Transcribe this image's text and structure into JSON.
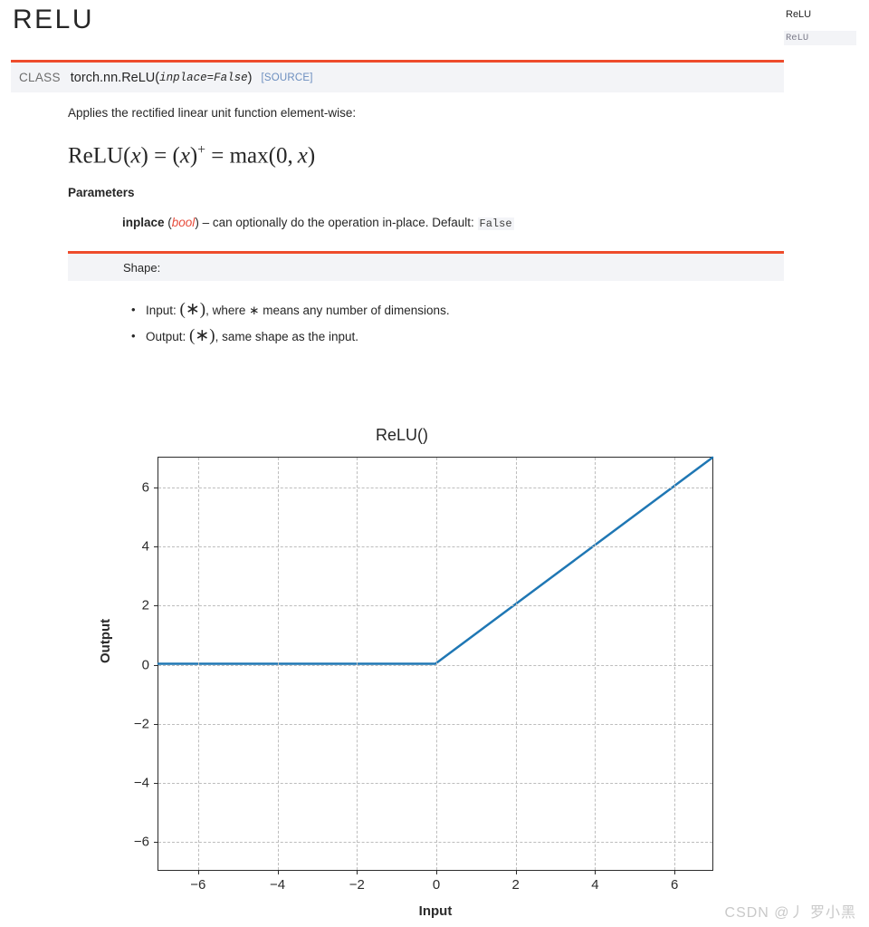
{
  "page": {
    "title": "RELU",
    "watermark": "CSDN @丿 罗小黑"
  },
  "sidebar": {
    "items": [
      {
        "label": "ReLU",
        "style": "link"
      },
      {
        "label": "ReLU",
        "style": "current"
      }
    ]
  },
  "signature": {
    "class_label": "CLASS",
    "qualified_name": "torch.nn.ReLU",
    "open_paren": "(",
    "argument": "inplace=False",
    "close_paren": ")",
    "source_link": "[SOURCE]",
    "accent_color": "#ee4c2c",
    "band_color": "#f3f4f7"
  },
  "description": "Applies the rectified linear unit function element-wise:",
  "formula": {
    "lhs_fn": "ReLU",
    "lhs_arg": "x",
    "plus_form": "(x)",
    "plus_sup": "+",
    "rhs": "max(0, x)",
    "plain": "ReLU(x) = (x)+ = max(0, x)"
  },
  "parameters": {
    "heading": "Parameters",
    "rows": [
      {
        "name": "inplace",
        "type": "bool",
        "description": "– can optionally do the operation in-place. Default:",
        "default": "False"
      }
    ]
  },
  "shape": {
    "heading": "Shape:",
    "items": [
      {
        "label": "Input:",
        "symbol": "(∗)",
        "text": ", where ∗ means any number of dimensions."
      },
      {
        "label": "Output:",
        "symbol": "(∗)",
        "text": ", same shape as the input."
      }
    ]
  },
  "chart_data": {
    "type": "line",
    "title": "ReLU()",
    "xlabel": "Input",
    "ylabel": "Output",
    "xlim": [
      -7,
      7
    ],
    "ylim": [
      -7,
      7
    ],
    "xticks": [
      -6,
      -4,
      -2,
      0,
      2,
      4,
      6
    ],
    "yticks": [
      -6,
      -4,
      -2,
      0,
      2,
      4,
      6
    ],
    "xticklabels": [
      "−6",
      "−4",
      "−2",
      "0",
      "2",
      "4",
      "6"
    ],
    "yticklabels": [
      "−6",
      "−4",
      "−2",
      "0",
      "2",
      "4",
      "6"
    ],
    "grid": true,
    "grid_style": "dashed",
    "legend": "none",
    "series": [
      {
        "name": "ReLU(x)",
        "color": "#1f77b4",
        "linewidth": 2.5,
        "x": [
          -7,
          -6,
          -5,
          -4,
          -3,
          -2,
          -1,
          0,
          1,
          2,
          3,
          4,
          5,
          6,
          7
        ],
        "y": [
          0,
          0,
          0,
          0,
          0,
          0,
          0,
          0,
          1,
          2,
          3,
          4,
          5,
          6,
          7
        ]
      }
    ]
  }
}
